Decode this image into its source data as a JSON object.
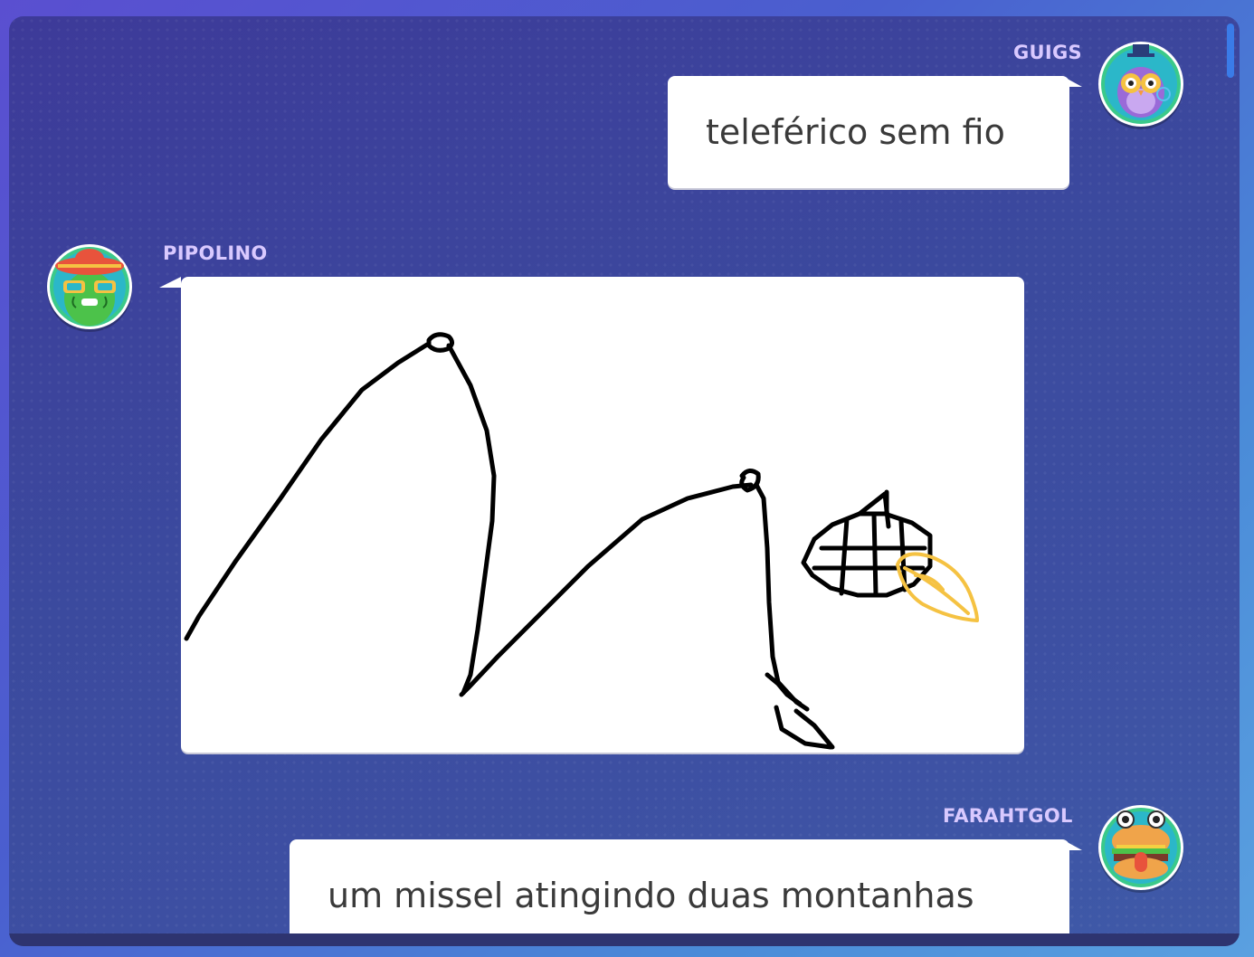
{
  "messages": [
    {
      "user": "GUIGS",
      "side": "right",
      "type": "text",
      "text": "teleférico sem fio",
      "avatar": "owl-avatar"
    },
    {
      "user": "PIPOLINO",
      "side": "left",
      "type": "drawing",
      "avatar": "cactus-avatar",
      "drawing_icon": "cable-car-mountains-drawing"
    },
    {
      "user": "FARAHTGOL",
      "side": "right",
      "type": "text",
      "text": "um missel atingindo duas montanhas",
      "avatar": "burger-avatar"
    }
  ],
  "colors": {
    "background_top": "#5a4fd0",
    "panel": "#3d3a99",
    "username": "#d9c9ff",
    "bubble": "#ffffff",
    "bubble_text": "#3a3a3a",
    "scrollbar": "#3a7be8",
    "drawing_stroke": "#000000",
    "drawing_accent": "#f5c242"
  }
}
